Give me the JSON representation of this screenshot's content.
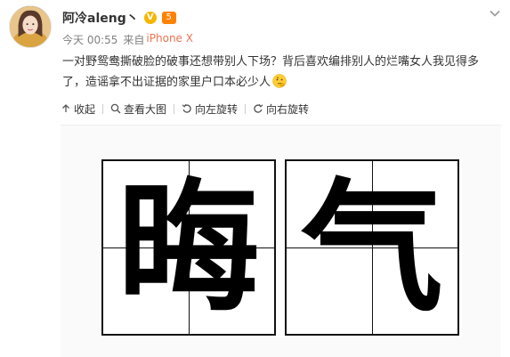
{
  "user": {
    "name": "阿冷aleng丶",
    "verified_badge": "V",
    "vip_badge": "5"
  },
  "meta": {
    "time": "今天 00:55",
    "source_prefix": "来自",
    "source": "iPhone X"
  },
  "post": {
    "text": "一对野鸳鸯撕破脸的破事还想带别人下场？背后喜欢编排别人的烂嘴女人我见得多了，造谣拿不出证据的家里户口本必少人",
    "emoji_icon": "thinking-face-emoji"
  },
  "toolbar": {
    "collapse": "收起",
    "view_large": "查看大图",
    "rotate_left": "向左旋转",
    "rotate_right": "向右旋转"
  },
  "image": {
    "char_1": "晦",
    "char_2": "气"
  },
  "colors": {
    "accent": "#eb7350",
    "verified": "#f7b500",
    "vip": "#ff8200"
  }
}
